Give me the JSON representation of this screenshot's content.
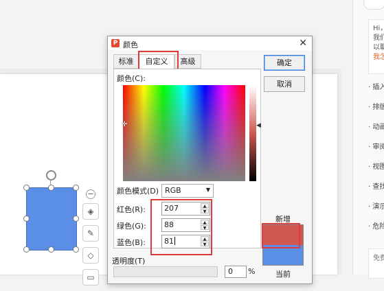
{
  "dialog": {
    "title": "颜色",
    "app_icon_letter": "P",
    "tabs": [
      {
        "label": "标准",
        "active": false
      },
      {
        "label": "自定义",
        "active": true
      },
      {
        "label": "高级",
        "active": false
      }
    ],
    "color_label": "颜色(C):",
    "color_mode_label": "颜色模式(D)",
    "color_mode_value": "RGB",
    "red_label": "红色(R):",
    "red_value": "207",
    "green_label": "绿色(G):",
    "green_value": "88",
    "blue_label": "蓝色(B):",
    "blue_value": "81",
    "transparency_label": "透明度(T)",
    "transparency_value": "0",
    "transparency_unit": "%",
    "ok_label": "确定",
    "cancel_label": "取消",
    "new_label": "新增",
    "current_label": "当前",
    "new_color": "#cf5851",
    "current_color": "#5b8ee6"
  },
  "right_panel": {
    "chat_lines": [
      "Hi，",
      "我们",
      "以聊",
      "我怎"
    ],
    "items": [
      "插入",
      "排版",
      "动画",
      "审阅",
      "视图",
      "查找",
      "演示",
      "危险"
    ],
    "bottom_text": "免费"
  },
  "colors": {
    "highlight_box": "#e03a3a",
    "shape_fill": "#5b8ee6",
    "selected_color": "#cf5851"
  }
}
